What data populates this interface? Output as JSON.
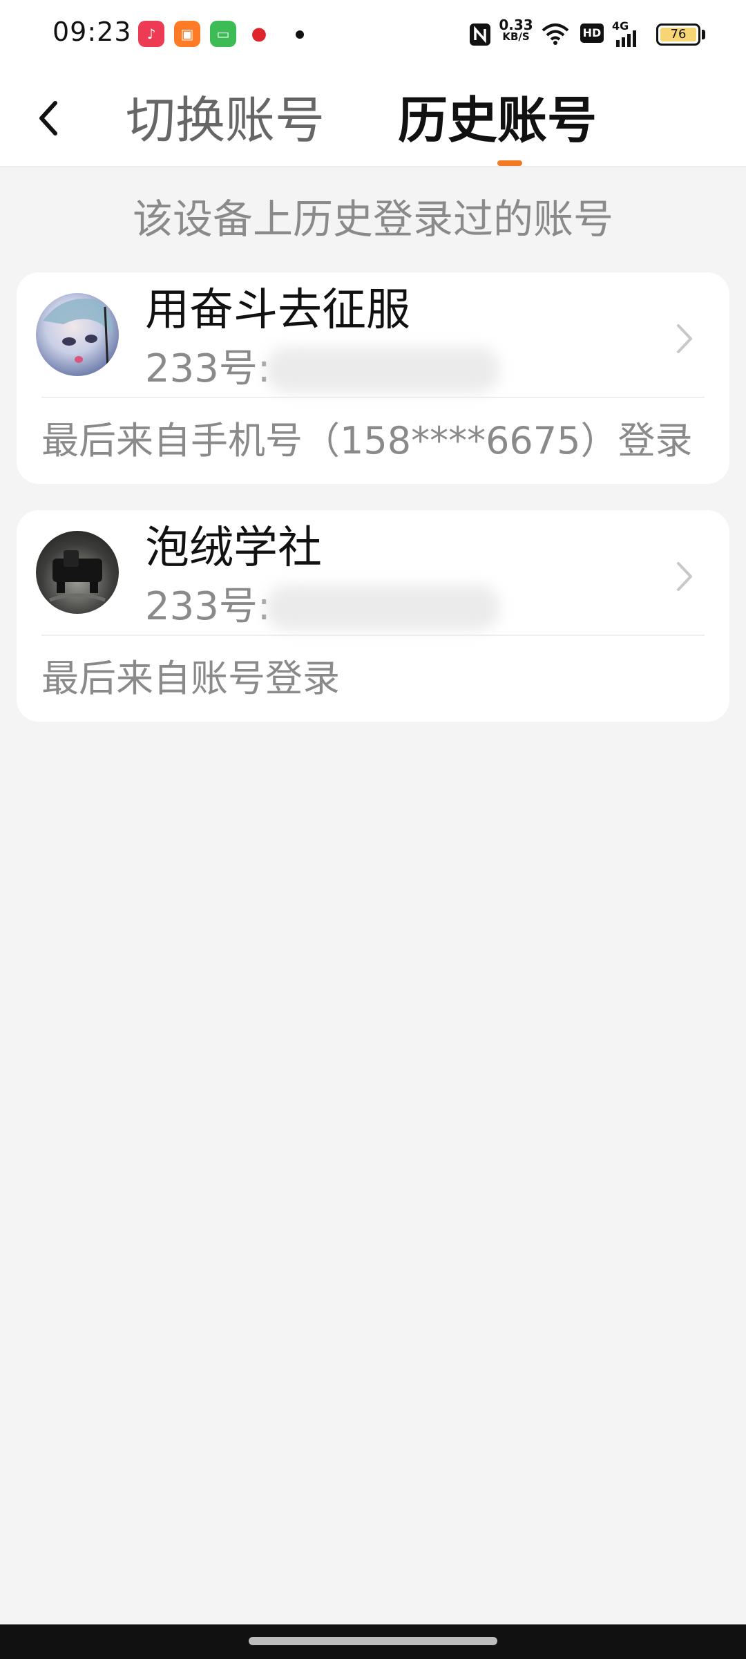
{
  "status_bar": {
    "time": "09:23",
    "net_speed_value": "0.33",
    "net_speed_unit": "KB/S",
    "hd": "HD",
    "network": "4G",
    "battery": "76",
    "icons": [
      "music-app-icon",
      "video-app-icon",
      "message-app-icon",
      "record-app-icon",
      "nfc-icon",
      "wifi-icon",
      "signal-icon"
    ]
  },
  "header": {
    "tabs": [
      {
        "label": "切换账号",
        "active": false
      },
      {
        "label": "历史账号",
        "active": true
      }
    ],
    "accent_color": "#f27a22"
  },
  "hint": "该设备上历史登录过的账号",
  "accounts": [
    {
      "name": "用奋斗去征服",
      "id_label": "233号:",
      "last_login": "最后来自手机号（158****6675）登录"
    },
    {
      "name": "泡绒学社",
      "id_label": "233号:",
      "last_login": "最后来自账号登录"
    }
  ]
}
